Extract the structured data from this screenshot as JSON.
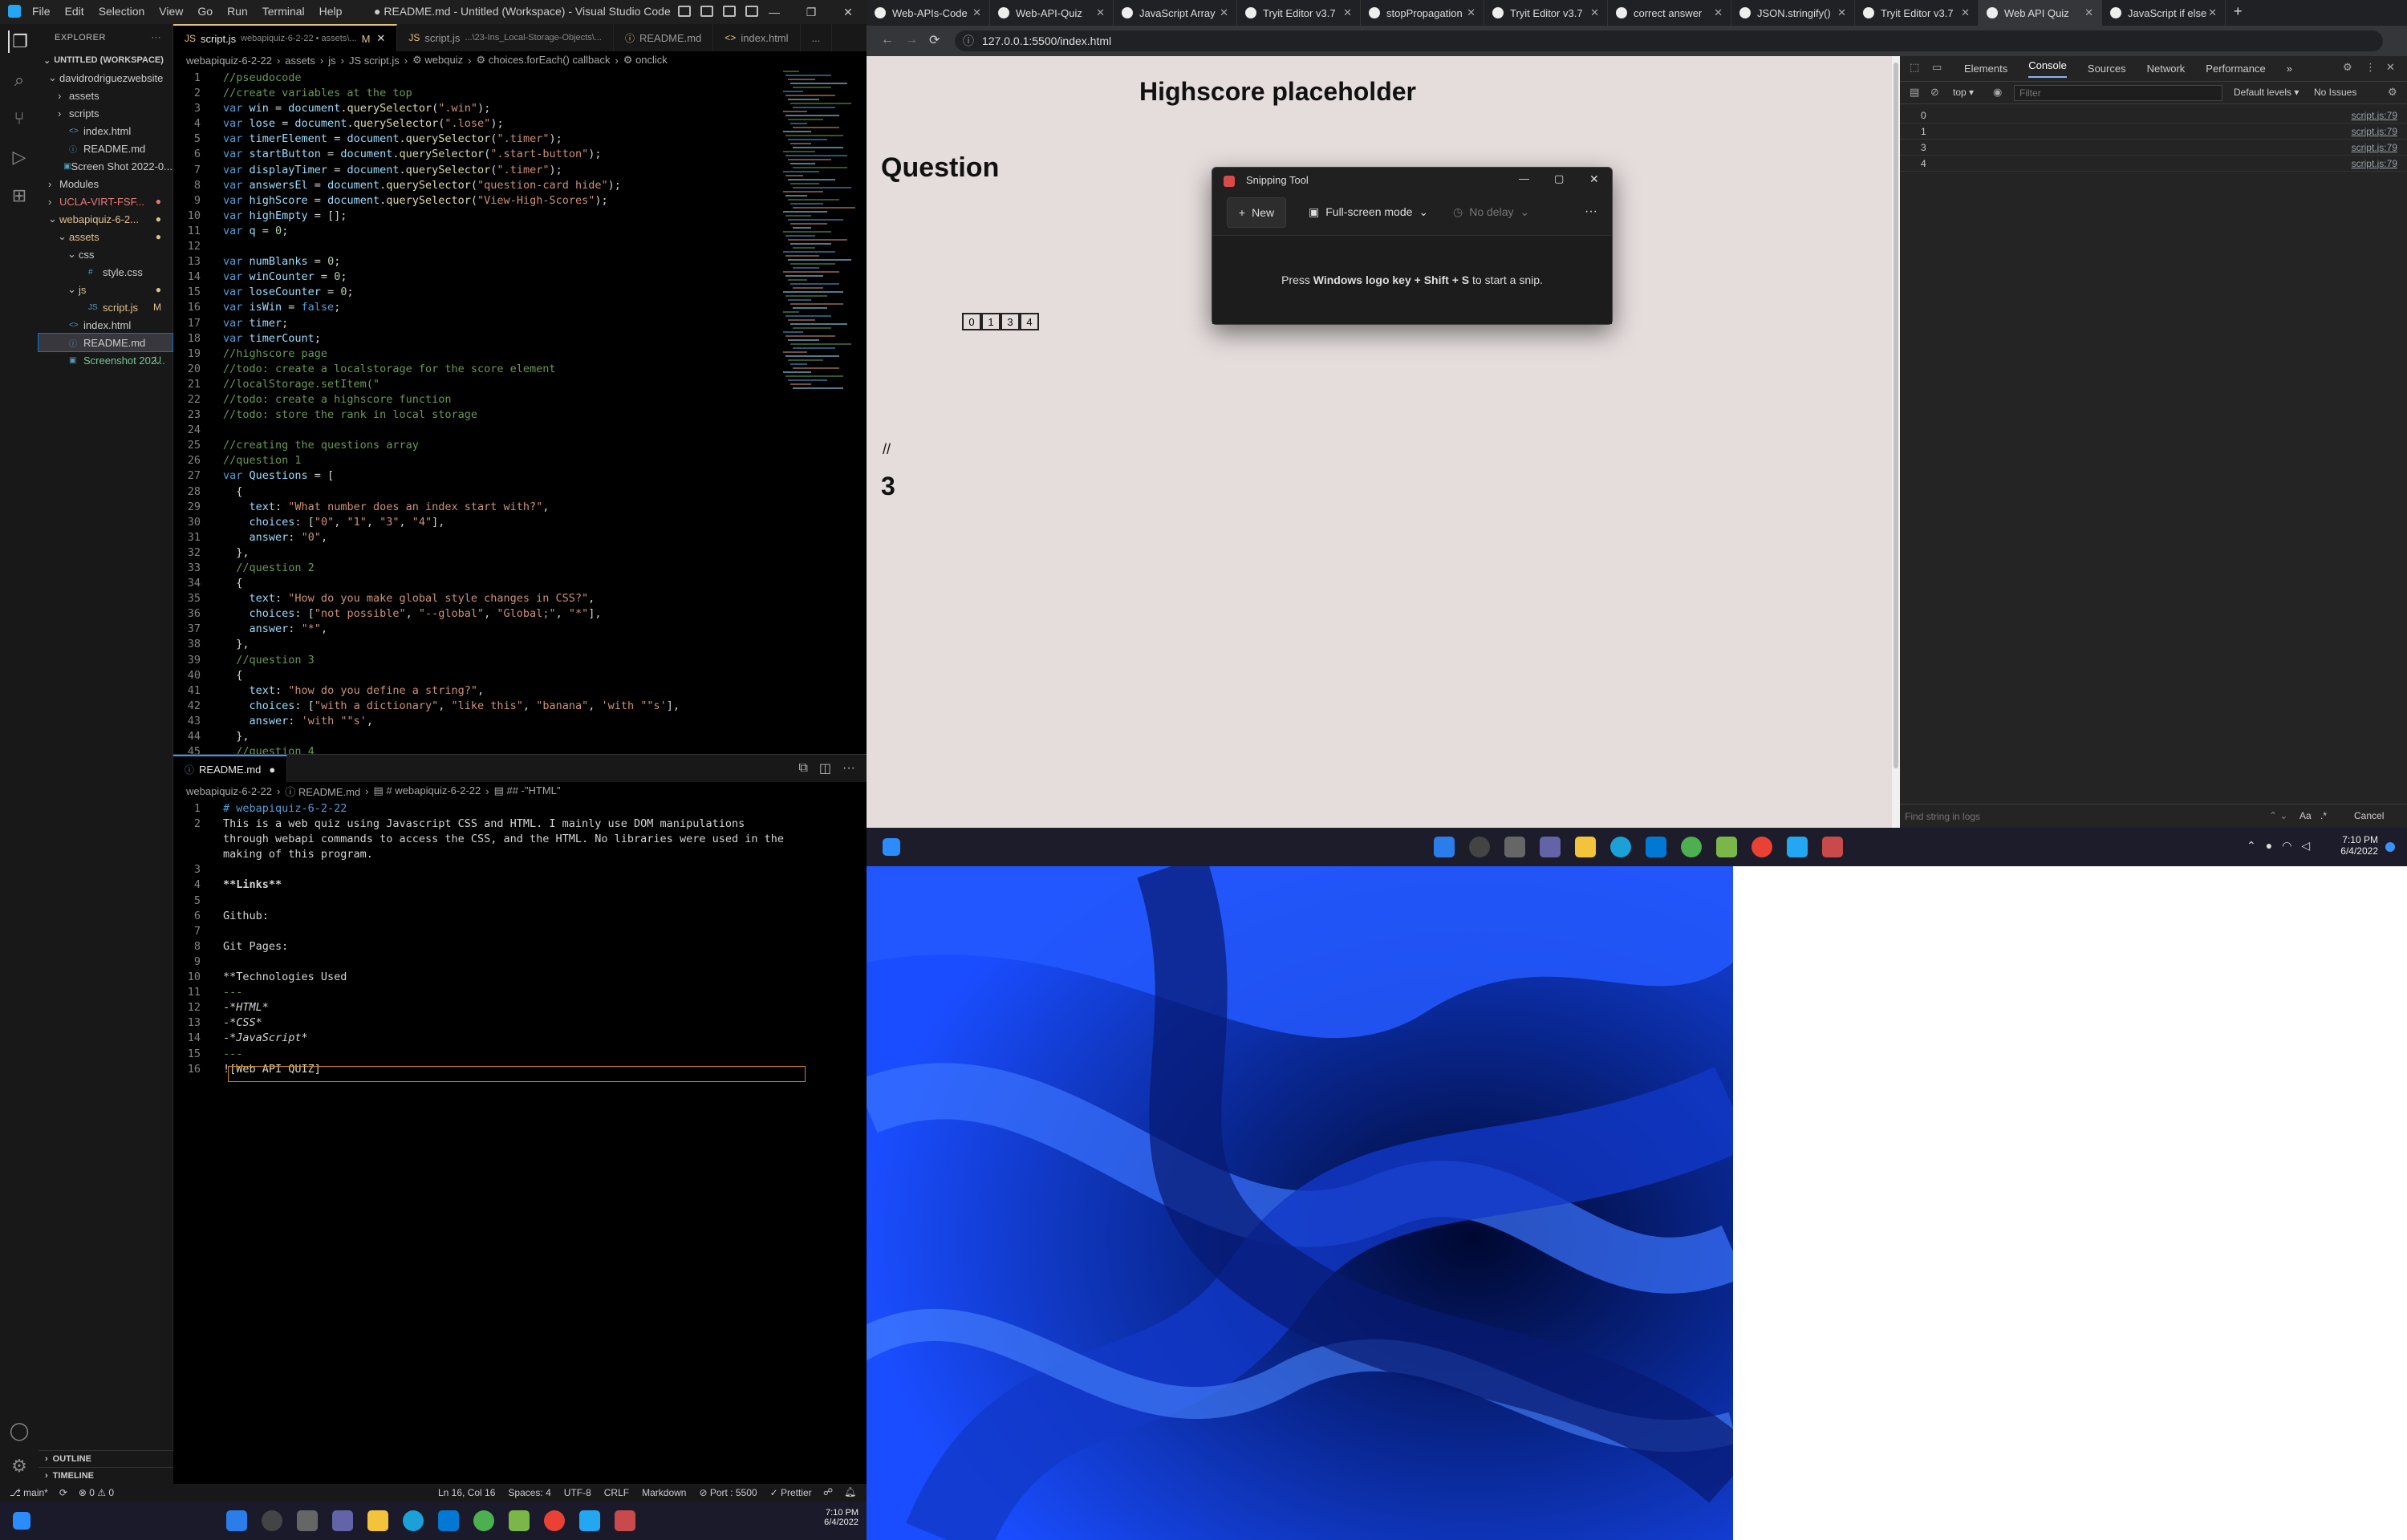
{
  "vscode": {
    "menu": [
      "File",
      "Edit",
      "Selection",
      "View",
      "Go",
      "Run",
      "Terminal",
      "Help"
    ],
    "title": "● README.md - Untitled (Workspace) - Visual Studio Code",
    "explorer_title": "EXPLORER",
    "workspace": "UNTITLED (WORKSPACE)",
    "tree": [
      {
        "label": "davidrodriguezwebsite",
        "indent": 1,
        "arrow": "⌄",
        "color": "#ccc"
      },
      {
        "label": "assets",
        "indent": 2,
        "arrow": "›",
        "color": "#ccc"
      },
      {
        "label": "scripts",
        "indent": 2,
        "arrow": "›",
        "color": "#ccc"
      },
      {
        "label": "index.html",
        "indent": 2,
        "arrow": "",
        "icon": "<>",
        "color": "#ccc"
      },
      {
        "label": "README.md",
        "indent": 2,
        "arrow": "",
        "icon": "ⓘ",
        "color": "#ccc"
      },
      {
        "label": "Screen Shot 2022-0...",
        "indent": 2,
        "arrow": "",
        "icon": "▣",
        "color": "#ccc"
      },
      {
        "label": "Modules",
        "indent": 1,
        "arrow": "›",
        "color": "#ccc"
      },
      {
        "label": "UCLA-VIRT-FSF...",
        "indent": 1,
        "arrow": "›",
        "color": "#e37b78",
        "badge": "●"
      },
      {
        "label": "webapiquiz-6-2...",
        "indent": 1,
        "arrow": "⌄",
        "color": "#e2c08d",
        "badge": "●"
      },
      {
        "label": "assets",
        "indent": 2,
        "arrow": "⌄",
        "color": "#e2c08d",
        "badge": "●"
      },
      {
        "label": "css",
        "indent": 3,
        "arrow": "⌄",
        "color": "#ccc"
      },
      {
        "label": "style.css",
        "indent": 4,
        "arrow": "",
        "icon": "#",
        "color": "#ccc"
      },
      {
        "label": "js",
        "indent": 3,
        "arrow": "⌄",
        "color": "#e2c08d",
        "badge": "●"
      },
      {
        "label": "script.js",
        "indent": 4,
        "arrow": "",
        "icon": "JS",
        "color": "#e2c08d",
        "badge": "M"
      },
      {
        "label": "index.html",
        "indent": 2,
        "arrow": "",
        "icon": "<>",
        "color": "#ccc"
      },
      {
        "label": "README.md",
        "indent": 2,
        "arrow": "",
        "icon": "ⓘ",
        "color": "#ccc",
        "selected": true
      },
      {
        "label": "Screenshot 202...",
        "indent": 2,
        "arrow": "",
        "icon": "▣",
        "color": "#73c991",
        "badge": "U"
      }
    ],
    "outline": "OUTLINE",
    "timeline": "TIMELINE",
    "tabs_top": [
      {
        "label": "script.js",
        "detail": "webapiquiz-6-2-22 • assets\\...",
        "badge": "M",
        "icon": "JS",
        "active": true
      },
      {
        "label": "script.js",
        "detail": "...\\23-Ins_Local-Storage-Objects\\...",
        "icon": "JS"
      },
      {
        "label": "README.md",
        "icon": "ⓘ"
      },
      {
        "label": "index.html",
        "icon": "<>"
      },
      {
        "label": "...",
        "icon": ""
      }
    ],
    "breadcrumb_top": [
      "webapiquiz-6-2-22",
      "›",
      "assets",
      "›",
      "js",
      "›",
      "JS script.js",
      "›",
      "⚙ webquiz",
      "›",
      "⚙ choices.forEach() callback",
      "›",
      "⚙ onclick"
    ],
    "code_top": [
      [
        [
          "c",
          "//pseudocode"
        ]
      ],
      [
        [
          "c",
          "//create variables at the top"
        ]
      ],
      [
        [
          "k",
          "var "
        ],
        [
          "v",
          "win"
        ],
        [
          "t",
          " = "
        ],
        [
          "v",
          "document"
        ],
        [
          "t",
          "."
        ],
        [
          "f",
          "querySelector"
        ],
        [
          "t",
          "("
        ],
        [
          "s",
          "\".win\""
        ],
        [
          "t",
          ");"
        ]
      ],
      [
        [
          "k",
          "var "
        ],
        [
          "v",
          "lose"
        ],
        [
          "t",
          " = "
        ],
        [
          "v",
          "document"
        ],
        [
          "t",
          "."
        ],
        [
          "f",
          "querySelector"
        ],
        [
          "t",
          "("
        ],
        [
          "s",
          "\".lose\""
        ],
        [
          "t",
          ");"
        ]
      ],
      [
        [
          "k",
          "var "
        ],
        [
          "v",
          "timerElement"
        ],
        [
          "t",
          " = "
        ],
        [
          "v",
          "document"
        ],
        [
          "t",
          "."
        ],
        [
          "f",
          "querySelector"
        ],
        [
          "t",
          "("
        ],
        [
          "s",
          "\".timer\""
        ],
        [
          "t",
          ");"
        ]
      ],
      [
        [
          "k",
          "var "
        ],
        [
          "v",
          "startButton"
        ],
        [
          "t",
          " = "
        ],
        [
          "v",
          "document"
        ],
        [
          "t",
          "."
        ],
        [
          "f",
          "querySelector"
        ],
        [
          "t",
          "("
        ],
        [
          "s",
          "\".start-button\""
        ],
        [
          "t",
          ");"
        ]
      ],
      [
        [
          "k",
          "var "
        ],
        [
          "v",
          "displayTimer"
        ],
        [
          "t",
          " = "
        ],
        [
          "v",
          "document"
        ],
        [
          "t",
          "."
        ],
        [
          "f",
          "querySelector"
        ],
        [
          "t",
          "("
        ],
        [
          "s",
          "\".timer\""
        ],
        [
          "t",
          ");"
        ]
      ],
      [
        [
          "k",
          "var "
        ],
        [
          "v",
          "answersEl"
        ],
        [
          "t",
          " = "
        ],
        [
          "v",
          "document"
        ],
        [
          "t",
          "."
        ],
        [
          "f",
          "querySelector"
        ],
        [
          "t",
          "("
        ],
        [
          "s",
          "\"question-card hide\""
        ],
        [
          "t",
          ");"
        ]
      ],
      [
        [
          "k",
          "var "
        ],
        [
          "v",
          "highScore"
        ],
        [
          "t",
          " = "
        ],
        [
          "v",
          "document"
        ],
        [
          "t",
          "."
        ],
        [
          "f",
          "querySelector"
        ],
        [
          "t",
          "("
        ],
        [
          "s",
          "\"View-High-Scores\""
        ],
        [
          "t",
          ");"
        ]
      ],
      [
        [
          "k",
          "var "
        ],
        [
          "v",
          "highEmpty"
        ],
        [
          "t",
          " = [];"
        ]
      ],
      [
        [
          "k",
          "var "
        ],
        [
          "v",
          "q"
        ],
        [
          "t",
          " = "
        ],
        [
          "n",
          "0"
        ],
        [
          "t",
          ";"
        ]
      ],
      [
        [
          "t",
          ""
        ]
      ],
      [
        [
          "k",
          "var "
        ],
        [
          "v",
          "numBlanks"
        ],
        [
          "t",
          " = "
        ],
        [
          "n",
          "0"
        ],
        [
          "t",
          ";"
        ]
      ],
      [
        [
          "k",
          "var "
        ],
        [
          "v",
          "winCounter"
        ],
        [
          "t",
          " = "
        ],
        [
          "n",
          "0"
        ],
        [
          "t",
          ";"
        ]
      ],
      [
        [
          "k",
          "var "
        ],
        [
          "v",
          "loseCounter"
        ],
        [
          "t",
          " = "
        ],
        [
          "n",
          "0"
        ],
        [
          "t",
          ";"
        ]
      ],
      [
        [
          "k",
          "var "
        ],
        [
          "v",
          "isWin"
        ],
        [
          "t",
          " = "
        ],
        [
          "k",
          "false"
        ],
        [
          "t",
          ";"
        ]
      ],
      [
        [
          "k",
          "var "
        ],
        [
          "v",
          "timer"
        ],
        [
          "t",
          ";"
        ]
      ],
      [
        [
          "k",
          "var "
        ],
        [
          "v",
          "timerCount"
        ],
        [
          "t",
          ";"
        ]
      ],
      [
        [
          "c",
          "//highscore page"
        ]
      ],
      [
        [
          "c",
          "//todo: create a localstorage for the score element"
        ]
      ],
      [
        [
          "c",
          "//localStorage.setItem(\""
        ]
      ],
      [
        [
          "c",
          "//todo: create a highscore function"
        ]
      ],
      [
        [
          "c",
          "//todo: store the rank in local storage"
        ]
      ],
      [
        [
          "t",
          ""
        ]
      ],
      [
        [
          "c",
          "//creating the questions array"
        ]
      ],
      [
        [
          "c",
          "//question 1"
        ]
      ],
      [
        [
          "k",
          "var "
        ],
        [
          "v",
          "Questions"
        ],
        [
          "t",
          " = ["
        ]
      ],
      [
        [
          "t",
          "  {"
        ]
      ],
      [
        [
          "t",
          "    "
        ],
        [
          "v",
          "text"
        ],
        [
          "t",
          ": "
        ],
        [
          "s",
          "\"What number does an index start with?\""
        ],
        [
          "t",
          ","
        ]
      ],
      [
        [
          "t",
          "    "
        ],
        [
          "v",
          "choices"
        ],
        [
          "t",
          ": ["
        ],
        [
          "s",
          "\"0\""
        ],
        [
          "t",
          ", "
        ],
        [
          "s",
          "\"1\""
        ],
        [
          "t",
          ", "
        ],
        [
          "s",
          "\"3\""
        ],
        [
          "t",
          ", "
        ],
        [
          "s",
          "\"4\""
        ],
        [
          "t",
          "],"
        ]
      ],
      [
        [
          "t",
          "    "
        ],
        [
          "v",
          "answer"
        ],
        [
          "t",
          ": "
        ],
        [
          "s",
          "\"0\""
        ],
        [
          "t",
          ","
        ]
      ],
      [
        [
          "t",
          "  },"
        ]
      ],
      [
        [
          "t",
          "  "
        ],
        [
          "c",
          "//question 2"
        ]
      ],
      [
        [
          "t",
          "  {"
        ]
      ],
      [
        [
          "t",
          "    "
        ],
        [
          "v",
          "text"
        ],
        [
          "t",
          ": "
        ],
        [
          "s",
          "\"How do you make global style changes in CSS?\""
        ],
        [
          "t",
          ","
        ]
      ],
      [
        [
          "t",
          "    "
        ],
        [
          "v",
          "choices"
        ],
        [
          "t",
          ": ["
        ],
        [
          "s",
          "\"not possible\""
        ],
        [
          "t",
          ", "
        ],
        [
          "s",
          "\"--global\""
        ],
        [
          "t",
          ", "
        ],
        [
          "s",
          "\"Global;\""
        ],
        [
          "t",
          ", "
        ],
        [
          "s",
          "\"*\""
        ],
        [
          "t",
          "],"
        ]
      ],
      [
        [
          "t",
          "    "
        ],
        [
          "v",
          "answer"
        ],
        [
          "t",
          ": "
        ],
        [
          "s",
          "\"*\""
        ],
        [
          "t",
          ","
        ]
      ],
      [
        [
          "t",
          "  },"
        ]
      ],
      [
        [
          "t",
          "  "
        ],
        [
          "c",
          "//question 3"
        ]
      ],
      [
        [
          "t",
          "  {"
        ]
      ],
      [
        [
          "t",
          "    "
        ],
        [
          "v",
          "text"
        ],
        [
          "t",
          ": "
        ],
        [
          "s",
          "\"how do you define a string?\""
        ],
        [
          "t",
          ","
        ]
      ],
      [
        [
          "t",
          "    "
        ],
        [
          "v",
          "choices"
        ],
        [
          "t",
          ": ["
        ],
        [
          "s",
          "\"with a dictionary\""
        ],
        [
          "t",
          ", "
        ],
        [
          "s",
          "\"like this\""
        ],
        [
          "t",
          ", "
        ],
        [
          "s",
          "\"banana\""
        ],
        [
          "t",
          ", "
        ],
        [
          "s",
          "'with \"\"s'"
        ],
        [
          "t",
          "],"
        ]
      ],
      [
        [
          "t",
          "    "
        ],
        [
          "v",
          "answer"
        ],
        [
          "t",
          ": "
        ],
        [
          "s",
          "'with \"\"s'"
        ],
        [
          "t",
          ","
        ]
      ],
      [
        [
          "t",
          "  },"
        ]
      ],
      [
        [
          "t",
          "  "
        ],
        [
          "c",
          "//question 4"
        ]
      ],
      [
        [
          "t",
          "  {"
        ]
      ]
    ],
    "tab_bottom": {
      "label": "README.md",
      "icon": "ⓘ",
      "dot": "●"
    },
    "breadcrumb_bottom": [
      "webapiquiz-6-2-22",
      "›",
      "ⓘ README.md",
      "›",
      "▤ # webapiquiz-6-2-22",
      "›",
      "▤ ## -\"HTML\""
    ],
    "code_bottom": [
      [
        [
          "k",
          "# webapiquiz-6-2-22"
        ]
      ],
      [
        [
          "t",
          "This is a web quiz using Javascript CSS and HTML. I mainly use DOM manipulations"
        ]
      ],
      [
        [
          "t",
          "through webapi commands to access the CSS, and the HTML. No libraries were used in the"
        ]
      ],
      [
        [
          "t",
          "making of this program."
        ]
      ],
      [
        [
          "t",
          ""
        ]
      ],
      [
        [
          "b",
          "**Links**"
        ]
      ],
      [
        [
          "t",
          ""
        ]
      ],
      [
        [
          "t",
          "Github:"
        ]
      ],
      [
        [
          "t",
          ""
        ]
      ],
      [
        [
          "t",
          "Git Pages:"
        ]
      ],
      [
        [
          "t",
          ""
        ]
      ],
      [
        [
          "t",
          "**Technologies Used"
        ]
      ],
      [
        [
          "c",
          "---"
        ]
      ],
      [
        [
          "t",
          "-"
        ],
        [
          "i",
          "*HTML*"
        ]
      ],
      [
        [
          "t",
          "-"
        ],
        [
          "i",
          "*CSS*"
        ]
      ],
      [
        [
          "t",
          "-"
        ],
        [
          "i",
          "*JavaScript*"
        ]
      ],
      [
        [
          "c",
          "---"
        ]
      ],
      [
        [
          "t",
          "![Web API QUIZ]"
        ]
      ]
    ],
    "bottom_line_numbers": [
      "1",
      "2",
      "",
      "",
      "3",
      "4",
      "5",
      "6",
      "7",
      "8",
      "9",
      "10",
      "11",
      "12",
      "13",
      "14",
      "15",
      "16"
    ],
    "status_left": [
      "⎇ main*",
      "⟳",
      "⊗ 0 ⚠ 0"
    ],
    "status_right": [
      "Ln 16, Col 16",
      "Spaces: 4",
      "UTF-8",
      "CRLF",
      "Markdown",
      "⊘ Port : 5500",
      "✓ Prettier"
    ],
    "clock_time": "7:10 PM",
    "clock_date": "6/4/2022"
  },
  "chrome": {
    "tabs": [
      {
        "label": "Web-APIs-Code"
      },
      {
        "label": "Web-API-Quiz"
      },
      {
        "label": "JavaScript Array"
      },
      {
        "label": "Tryit Editor v3.7"
      },
      {
        "label": "stopPropagation"
      },
      {
        "label": "Tryit Editor v3.7"
      },
      {
        "label": "correct answer"
      },
      {
        "label": "JSON.stringify()"
      },
      {
        "label": "Tryit Editor v3.7"
      },
      {
        "label": "Web API Quiz",
        "active": true
      },
      {
        "label": "JavaScript if else"
      }
    ],
    "url": "127.0.0.1:5500/index.html",
    "page": {
      "heading": "Highscore placeholder",
      "question": "Question",
      "choices": [
        "0",
        "1",
        "3",
        "4"
      ],
      "comment": "//",
      "number": "3"
    },
    "devtools": {
      "tabs": [
        "Elements",
        "Console",
        "Sources",
        "Network",
        "Performance",
        "»"
      ],
      "active_tab": "Console",
      "context": "top ▾",
      "filter_placeholder": "Filter",
      "levels": "Default levels ▾",
      "issues": "No Issues",
      "logs": [
        {
          "value": "0",
          "source": "script.js:79"
        },
        {
          "value": "1",
          "source": "script.js:79"
        },
        {
          "value": "3",
          "source": "script.js:79"
        },
        {
          "value": "4",
          "source": "script.js:79"
        }
      ],
      "find_placeholder": "Find string in logs",
      "match_case": "Aa",
      "regex": ".*",
      "cancel": "Cancel"
    }
  },
  "snip": {
    "title": "Snipping Tool",
    "new": "New",
    "mode": "Full-screen mode",
    "delay": "No delay",
    "more": "···",
    "msg_pre": "Press ",
    "msg_bold": "Windows logo key + Shift + S",
    "msg_post": " to start a snip."
  },
  "taskbar": {
    "time": "7:10 PM",
    "date": "6/4/2022"
  }
}
